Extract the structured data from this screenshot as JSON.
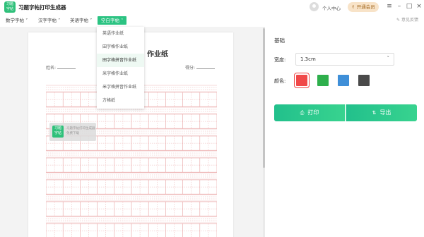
{
  "app": {
    "logo_text": "习题\n字帖",
    "title": "习题字帖打印生成器",
    "user_center": "个人中心",
    "vip_button": "开通会员",
    "feedback": "意见反馈"
  },
  "menu": [
    {
      "label": "数学字帖"
    },
    {
      "label": "汉字字帖"
    },
    {
      "label": "英语字帖"
    },
    {
      "label": "空白字帖",
      "active": true
    }
  ],
  "dropdown": [
    {
      "label": "英语作业纸"
    },
    {
      "label": "田字格作业纸"
    },
    {
      "label": "田字格拼音作业纸",
      "highlighted": true
    },
    {
      "label": "米字格作业纸"
    },
    {
      "label": "米字格拼音作业纸"
    },
    {
      "label": "方格纸"
    }
  ],
  "paper": {
    "title_suffix": "作业纸",
    "name_label": "姓名:",
    "score_label": "得分:",
    "grid_color": "#e8a0a0"
  },
  "watermark": {
    "logo_text": "习题\n字帖",
    "line1": "习题字帖打印生成器",
    "line2": "免费下载"
  },
  "panel": {
    "section_title": "基础",
    "width_label": "宽度:",
    "width_value": "1.3cm",
    "color_label": "颜色:",
    "colors": [
      "#f04848",
      "#2eaf4c",
      "#3f8fd8",
      "#4a4a4a"
    ],
    "selected_color_index": 0,
    "print_label": "打印",
    "export_label": "导出"
  }
}
